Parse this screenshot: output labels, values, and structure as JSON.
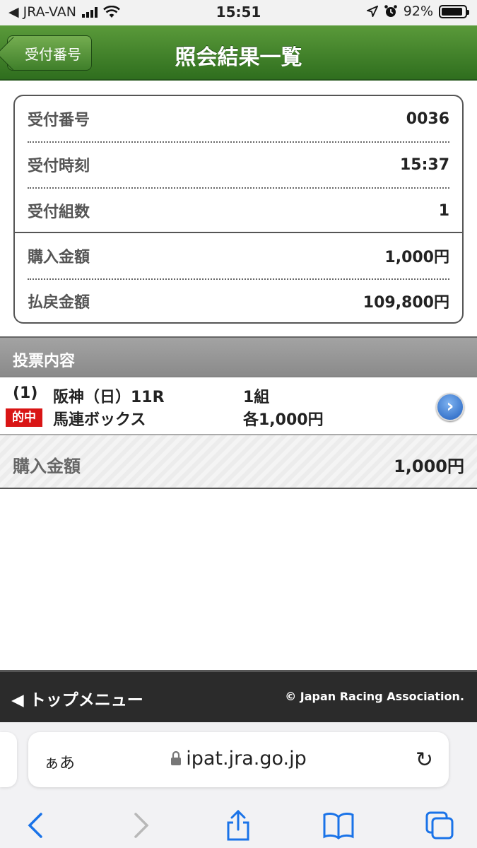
{
  "status_bar": {
    "carrier": "◀ JRA-VAN",
    "time": "15:51",
    "battery": "92%"
  },
  "header": {
    "back_label": "受付番号",
    "title": "照会結果一覧"
  },
  "summary": {
    "rows": [
      {
        "label": "受付番号",
        "value": "0036"
      },
      {
        "label": "受付時刻",
        "value": "15:37"
      },
      {
        "label": "受付組数",
        "value": "1"
      },
      {
        "label": "購入金額",
        "value": "1,000円"
      },
      {
        "label": "払戻金額",
        "value": "109,800円"
      }
    ]
  },
  "section": {
    "title": "投票内容"
  },
  "bet": {
    "number": "(1)",
    "race": "阪神（日）11R",
    "count": "1組",
    "hit_badge": "的中",
    "type": "馬連ボックス",
    "amount": "各1,000円"
  },
  "total": {
    "label": "購入金額",
    "value": "1,000円"
  },
  "footer": {
    "menu_label": "◀ トップメニュー",
    "copyright": "© Japan Racing Association."
  },
  "browser": {
    "aa_label": "ぁあ",
    "url": "ipat.jra.go.jp"
  },
  "colors": {
    "header_green": "#3f7f2a",
    "hit_red": "#d91515",
    "link_blue": "#1a73e8"
  }
}
